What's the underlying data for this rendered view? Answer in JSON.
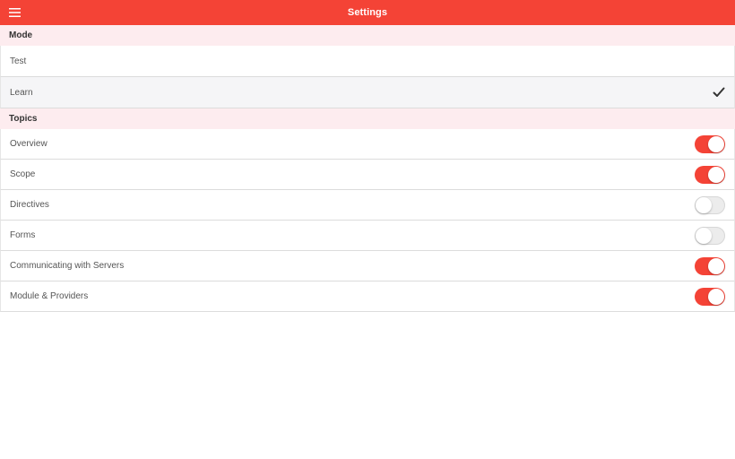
{
  "header": {
    "title": "Settings",
    "menu_icon": "hamburger-menu-icon",
    "background": "#f44336"
  },
  "mode": {
    "heading": "Mode",
    "options": [
      {
        "label": "Test",
        "selected": false
      },
      {
        "label": "Learn",
        "selected": true
      }
    ],
    "selected_icon": "checkmark-icon"
  },
  "topics": {
    "heading": "Topics",
    "items": [
      {
        "label": "Overview",
        "enabled": true
      },
      {
        "label": "Scope",
        "enabled": true
      },
      {
        "label": "Directives",
        "enabled": false
      },
      {
        "label": "Forms",
        "enabled": false
      },
      {
        "label": "Communicating with Servers",
        "enabled": true
      },
      {
        "label": "Module & Providers",
        "enabled": true
      }
    ]
  },
  "colors": {
    "accent": "#f44336",
    "section_background": "#fdecef",
    "selected_row": "#f5f5f7",
    "toggle_off": "#ececec"
  }
}
